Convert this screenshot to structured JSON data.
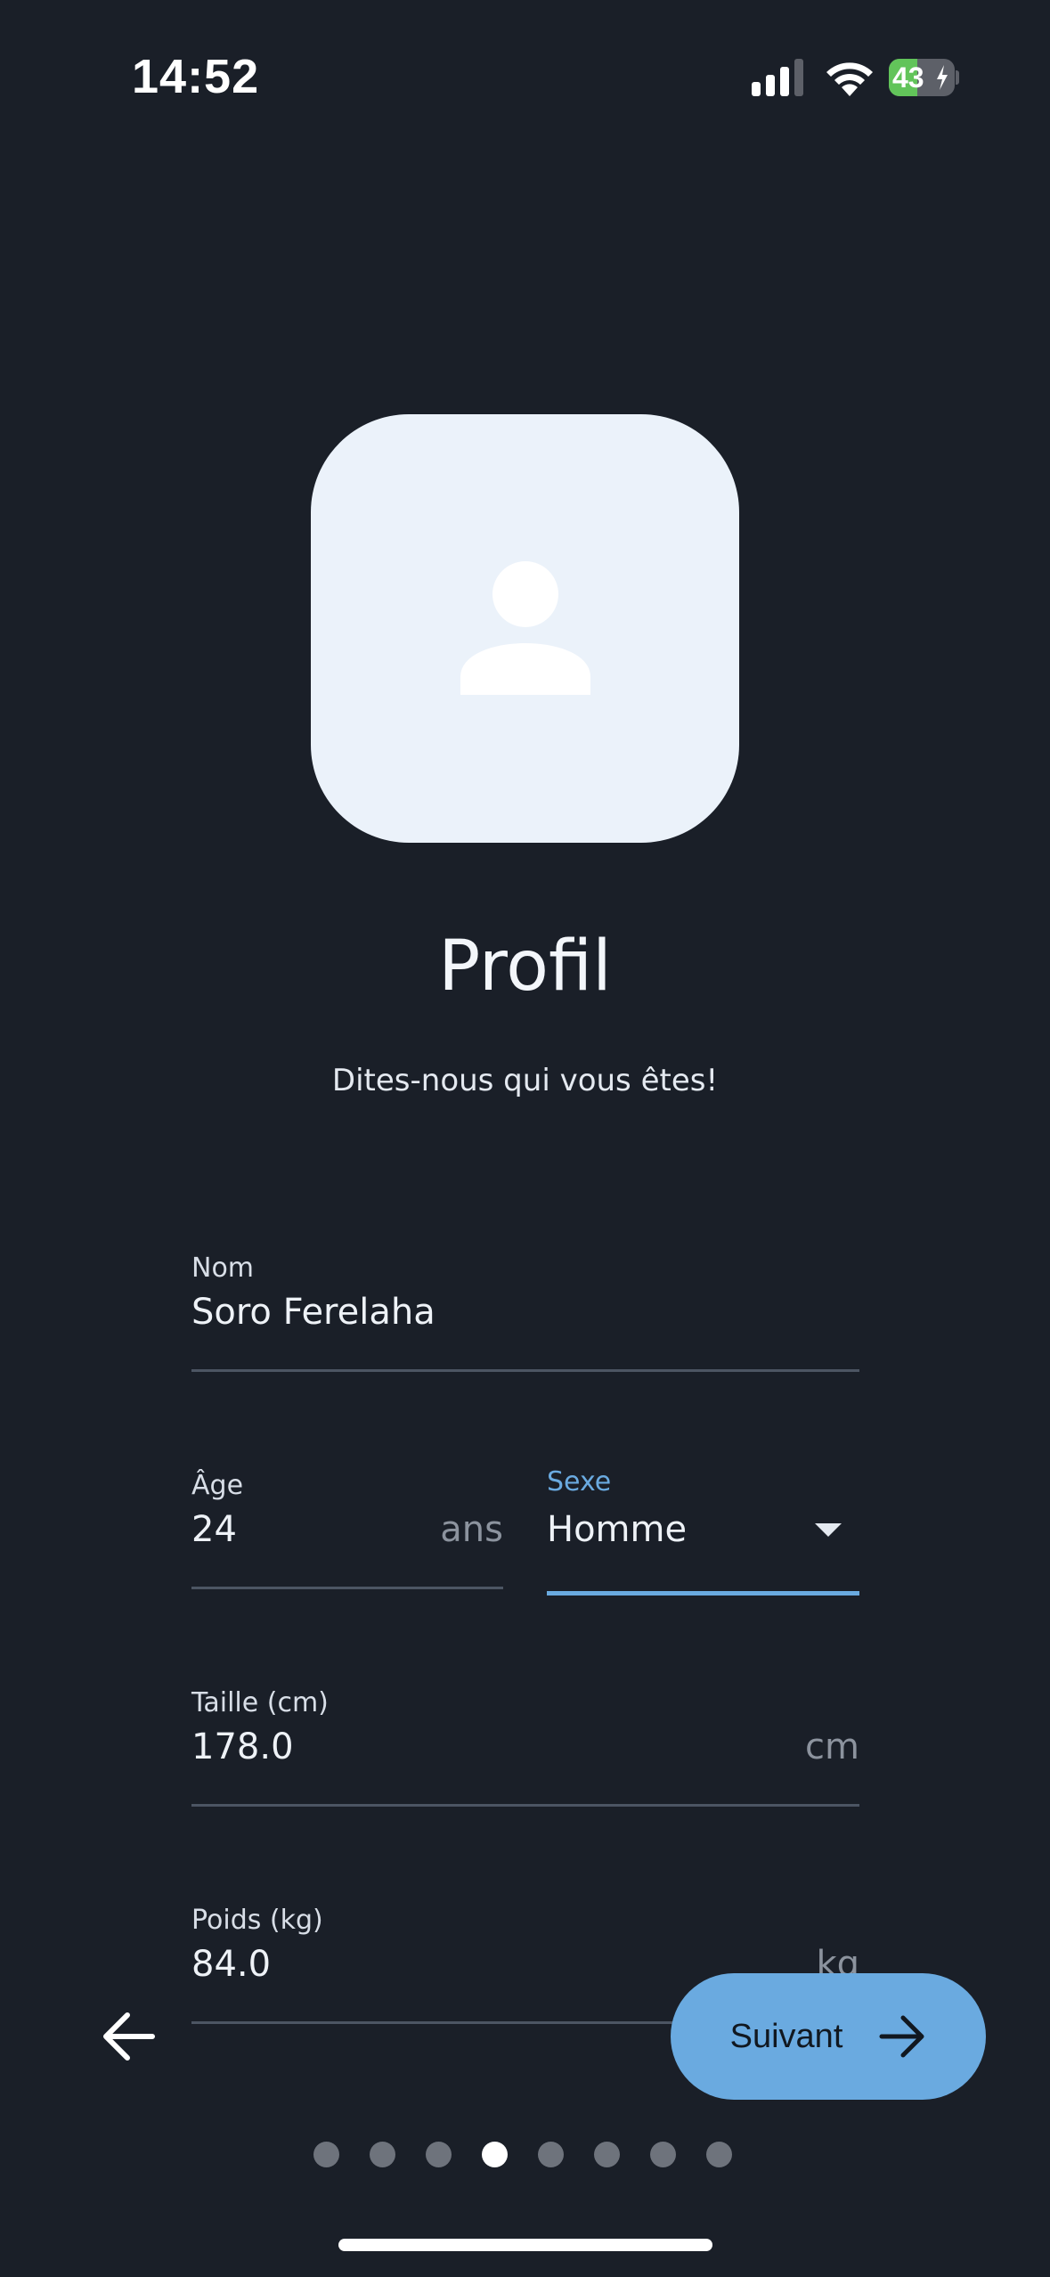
{
  "status_bar": {
    "time": "14:52",
    "battery_level": "43",
    "icons": [
      "signal-icon",
      "wifi-icon",
      "battery-charging-icon"
    ]
  },
  "header": {
    "avatar_icon": "person-icon",
    "title": "Profil",
    "subtitle": "Dites-nous qui vous êtes!"
  },
  "form": {
    "name": {
      "label": "Nom",
      "value": "Soro Ferelaha"
    },
    "age": {
      "label": "Âge",
      "value": "24",
      "suffix": "ans"
    },
    "sex": {
      "label": "Sexe",
      "value": "Homme"
    },
    "height": {
      "label": "Taille (cm)",
      "value": "178.0",
      "suffix": "cm"
    },
    "weight": {
      "label": "Poids (kg)",
      "value": "84.0",
      "suffix": "kg"
    }
  },
  "navigation": {
    "back_icon": "arrow-left-icon",
    "next_label": "Suivant",
    "next_icon": "arrow-right-icon",
    "total_steps": 8,
    "current_step": 4
  },
  "colors": {
    "background": "#1a1f28",
    "accent": "#6aaae0",
    "avatar_bg": "#ebf2fa",
    "battery": "#62c45a"
  }
}
